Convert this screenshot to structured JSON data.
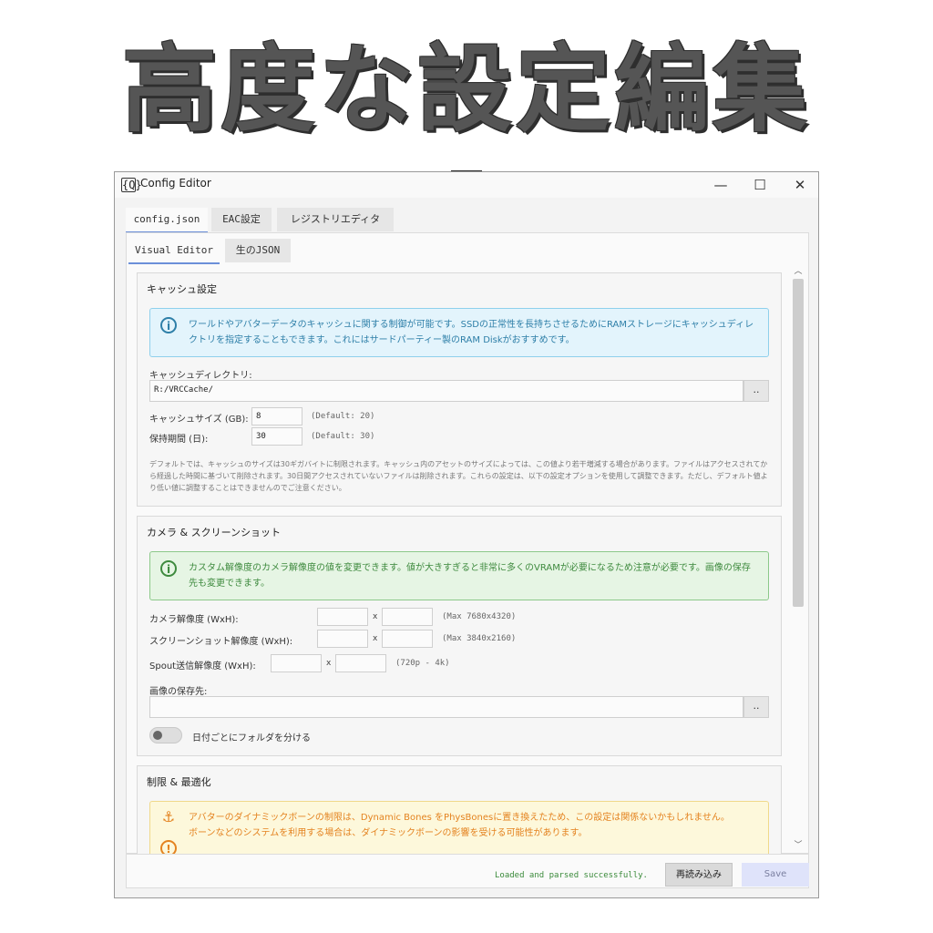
{
  "banner": {
    "title": "高度な設定編集"
  },
  "window": {
    "title": "Config Editor",
    "app_icon": "{Q}",
    "minimize": "—",
    "maximize": "☐",
    "close": "✕"
  },
  "outer_tabs": [
    "config.json",
    "EAC設定",
    "レジストリエディタ"
  ],
  "inner_tabs": [
    "Visual Editor",
    "生のJSON"
  ],
  "cache": {
    "title": "キャッシュ設定",
    "info": "ワールドやアバターデータのキャッシュに関する制御が可能です。SSDの正常性を長持ちさせるためにRAMストレージにキャッシュディレクトリを指定することもできます。これにはサードパーティー製のRAM Diskがおすすめです。",
    "dir_label": "キャッシュディレクトリ:",
    "dir_value": "R:/VRCCache/",
    "browse": "..",
    "size_label": "キャッシュサイズ (GB):",
    "size_value": "8",
    "size_hint": "(Default: 20)",
    "days_label": "保持期間 (日):",
    "days_value": "30",
    "days_hint": "(Default: 30)",
    "note": "デフォルトでは、キャッシュのサイズは30ギガバイトに制限されます。キャッシュ内のアセットのサイズによっては、この値より若干増減する場合があります。ファイルはアクセスされてから経過した時間に基づいて削除されます。30日間アクセスされていないファイルは削除されます。これらの設定は、以下の設定オプションを使用して調整できます。ただし、デフォルト値より低い値に調整することはできませんのでご注意ください。"
  },
  "camera": {
    "title": "カメラ & スクリーンショット",
    "info": "カスタム解像度のカメラ解像度の値を変更できます。値が大きすぎると非常に多くのVRAMが必要になるため注意が必要です。画像の保存先も変更できます。",
    "cam_label": "カメラ解像度 (WxH):",
    "cam_hint": "(Max 7680x4320)",
    "shot_label": "スクリーンショット解像度 (WxH):",
    "shot_hint": "(Max 3840x2160)",
    "spout_label": "Spout送信解像度 (WxH):",
    "spout_hint": "(720p - 4k)",
    "x": "x",
    "save_label": "画像の保存先:",
    "browse": "..",
    "toggle_label": "日付ごとにフォルダを分ける"
  },
  "limits": {
    "title": "制限 & 最適化",
    "info": "アバターのダイナミックボーンの制限は、Dynamic Bones をPhysBonesに置き換えたため、この設定は関係ないかもしれません。",
    "info2": "ボーンなどのシステムを利用する場合は、ダイナミックボーンの影響を受ける可能性があります。"
  },
  "footer": {
    "status": "Loaded and parsed successfully.",
    "reload": "再読み込み",
    "save": "Save"
  },
  "colors": {
    "accent": "#6b8fd9",
    "info_blue": "#2e7fa8",
    "info_green": "#3e8a3e",
    "info_orange": "#e48320",
    "status_green": "#3a8a3a"
  }
}
